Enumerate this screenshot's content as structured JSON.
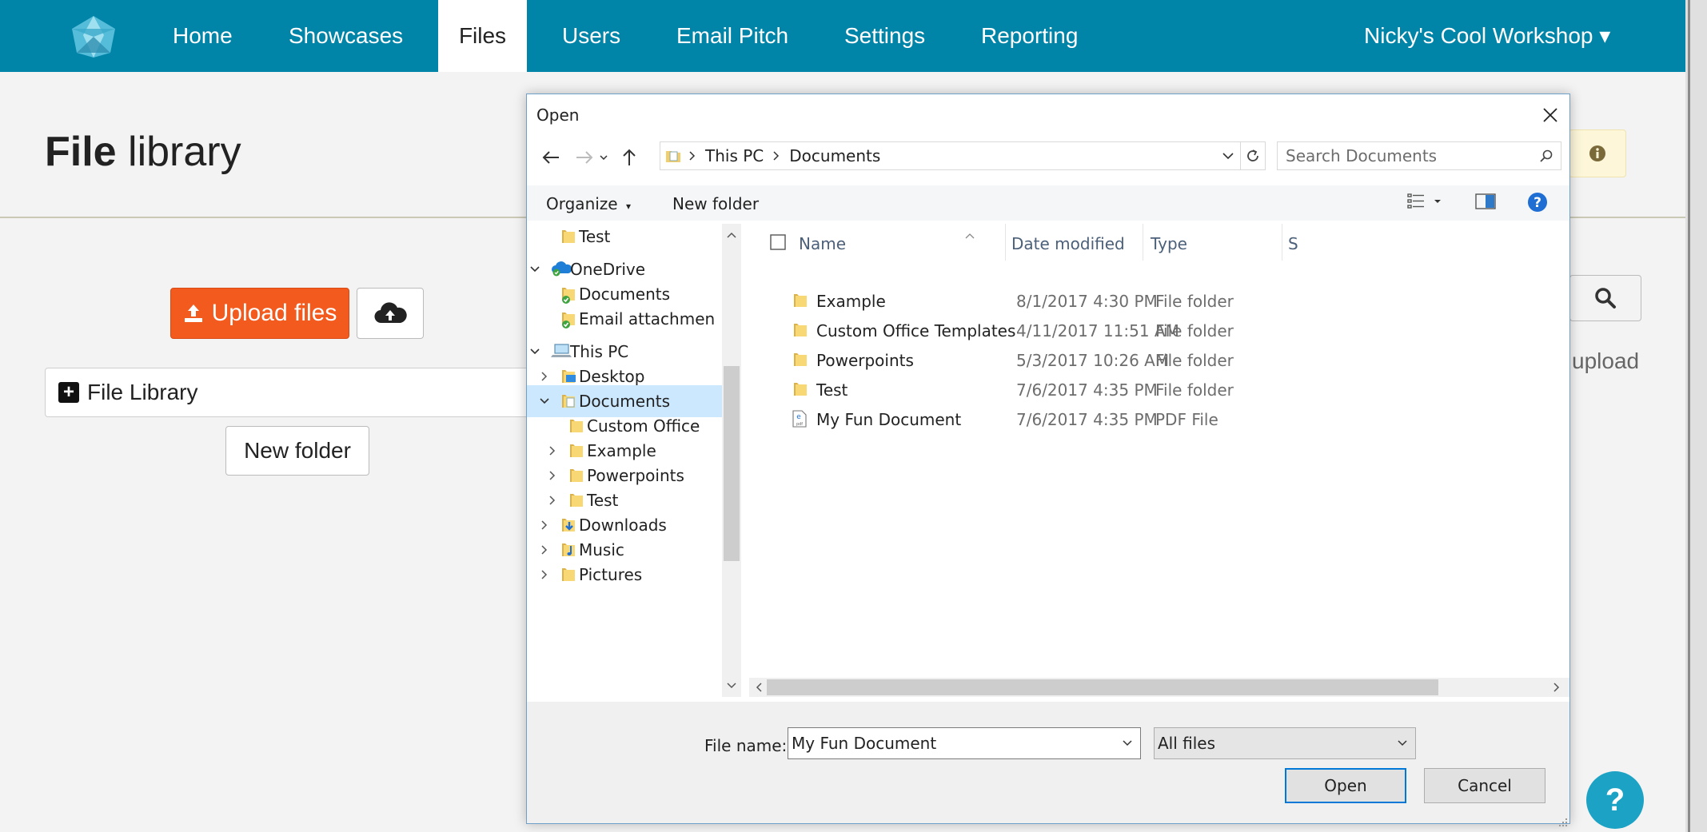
{
  "app": {
    "nav": {
      "items": [
        "Home",
        "Showcases",
        "Files",
        "Users",
        "Email Pitch",
        "Settings",
        "Reporting"
      ],
      "active": "Files",
      "workshop": "Nicky's Cool Workshop",
      "workshop_caret": "▾"
    },
    "page_title_bold": "File",
    "page_title_rest": " library",
    "upload_button": "Upload files",
    "library_bar": "File Library",
    "new_folder_button": "New folder",
    "upload_hint": "upload",
    "help": "?",
    "colors": {
      "nav": "#0084a8",
      "upload": "#f25a1e",
      "help": "#1ba2c5"
    }
  },
  "dialog": {
    "title": "Open",
    "breadcrumb": [
      "This PC",
      "Documents"
    ],
    "search_placeholder": "Search Documents",
    "toolbar": {
      "organize": "Organize",
      "new_folder": "New folder"
    },
    "nav_tree": [
      {
        "label": "Test",
        "icon": "folder",
        "level": 1,
        "chevron": ""
      },
      {
        "label": "OneDrive",
        "icon": "onedrive",
        "level": 0,
        "chevron": "expanded"
      },
      {
        "label": "Documents",
        "icon": "folder-synced",
        "level": 1,
        "chevron": ""
      },
      {
        "label": "Email attachmen",
        "icon": "folder-synced",
        "level": 1,
        "chevron": ""
      },
      {
        "label": "This PC",
        "icon": "pc",
        "level": 0,
        "chevron": "expanded"
      },
      {
        "label": "Desktop",
        "icon": "desktop",
        "level": 1,
        "chevron": "collapsed"
      },
      {
        "label": "Documents",
        "icon": "documents",
        "level": 1,
        "chevron": "expanded",
        "selected": true
      },
      {
        "label": "Custom Office",
        "icon": "folder",
        "level": 2,
        "chevron": ""
      },
      {
        "label": "Example",
        "icon": "folder",
        "level": 2,
        "chevron": "collapsed"
      },
      {
        "label": "Powerpoints",
        "icon": "folder",
        "level": 2,
        "chevron": "collapsed"
      },
      {
        "label": "Test",
        "icon": "folder",
        "level": 2,
        "chevron": "collapsed"
      },
      {
        "label": "Downloads",
        "icon": "downloads",
        "level": 1,
        "chevron": "collapsed"
      },
      {
        "label": "Music",
        "icon": "music",
        "level": 1,
        "chevron": "collapsed"
      },
      {
        "label": "Pictures",
        "icon": "folder",
        "level": 1,
        "chevron": "collapsed"
      }
    ],
    "columns": [
      "Name",
      "Date modified",
      "Type",
      "S"
    ],
    "files": [
      {
        "name": "Example",
        "date": "8/1/2017 4:30 PM",
        "type": "File folder",
        "icon": "folder"
      },
      {
        "name": "Custom Office Templates",
        "date": "4/11/2017 11:51 AM",
        "type": "File folder",
        "icon": "folder"
      },
      {
        "name": "Powerpoints",
        "date": "5/3/2017 10:26 AM",
        "type": "File folder",
        "icon": "folder"
      },
      {
        "name": "Test",
        "date": "7/6/2017 4:35 PM",
        "type": "File folder",
        "icon": "folder"
      },
      {
        "name": "My Fun Document",
        "date": "7/6/2017 4:35 PM",
        "type": "PDF File",
        "icon": "pdf"
      }
    ],
    "file_name_label": "File name:",
    "file_name_value": "My Fun Document",
    "file_type_value": "All files",
    "open_button": "Open",
    "cancel_button": "Cancel"
  }
}
